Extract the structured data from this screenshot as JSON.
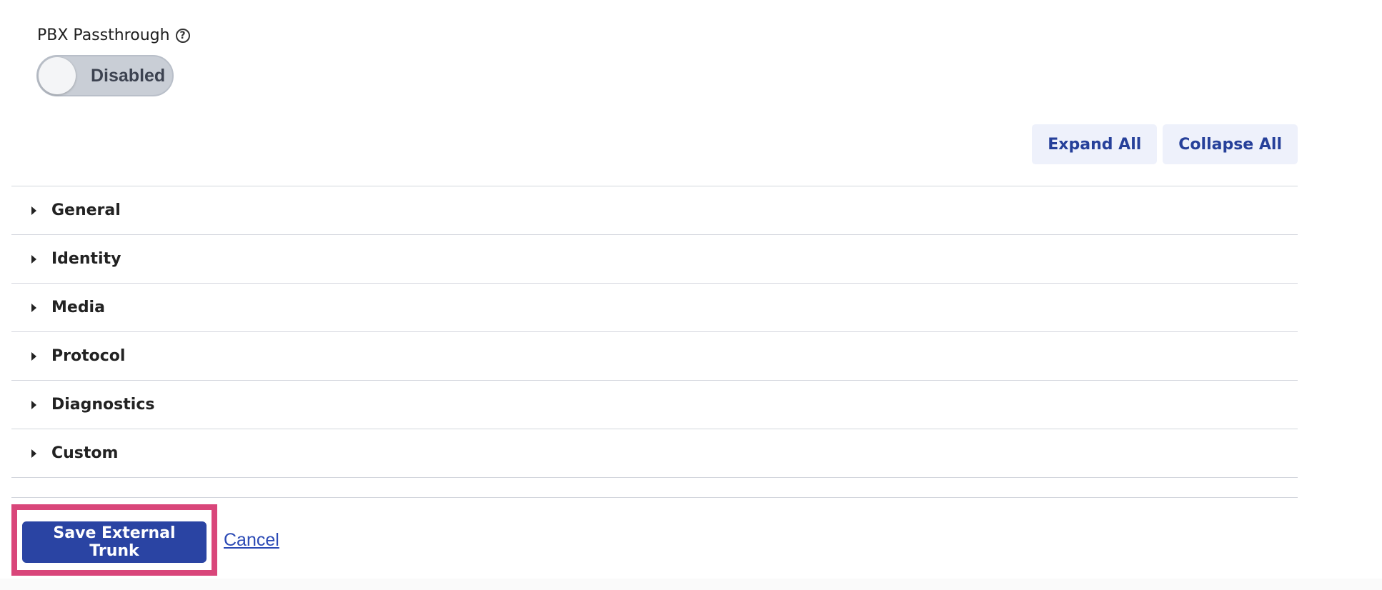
{
  "pbx_passthrough": {
    "label": "PBX Passthrough",
    "help_icon": "question-circle-icon",
    "help_glyph": "?",
    "toggle_state": "Disabled"
  },
  "controls": {
    "expand_all": "Expand All",
    "collapse_all": "Collapse All"
  },
  "sections": [
    {
      "title": "General"
    },
    {
      "title": "Identity"
    },
    {
      "title": "Media"
    },
    {
      "title": "Protocol"
    },
    {
      "title": "Diagnostics"
    },
    {
      "title": "Custom"
    }
  ],
  "actions": {
    "save_label": "Save External Trunk",
    "cancel_label": "Cancel"
  },
  "colors": {
    "primary": "#2a44a3",
    "highlight": "#d9467a",
    "secondary_bg": "#eef1fb",
    "link": "#2b4ab5"
  }
}
